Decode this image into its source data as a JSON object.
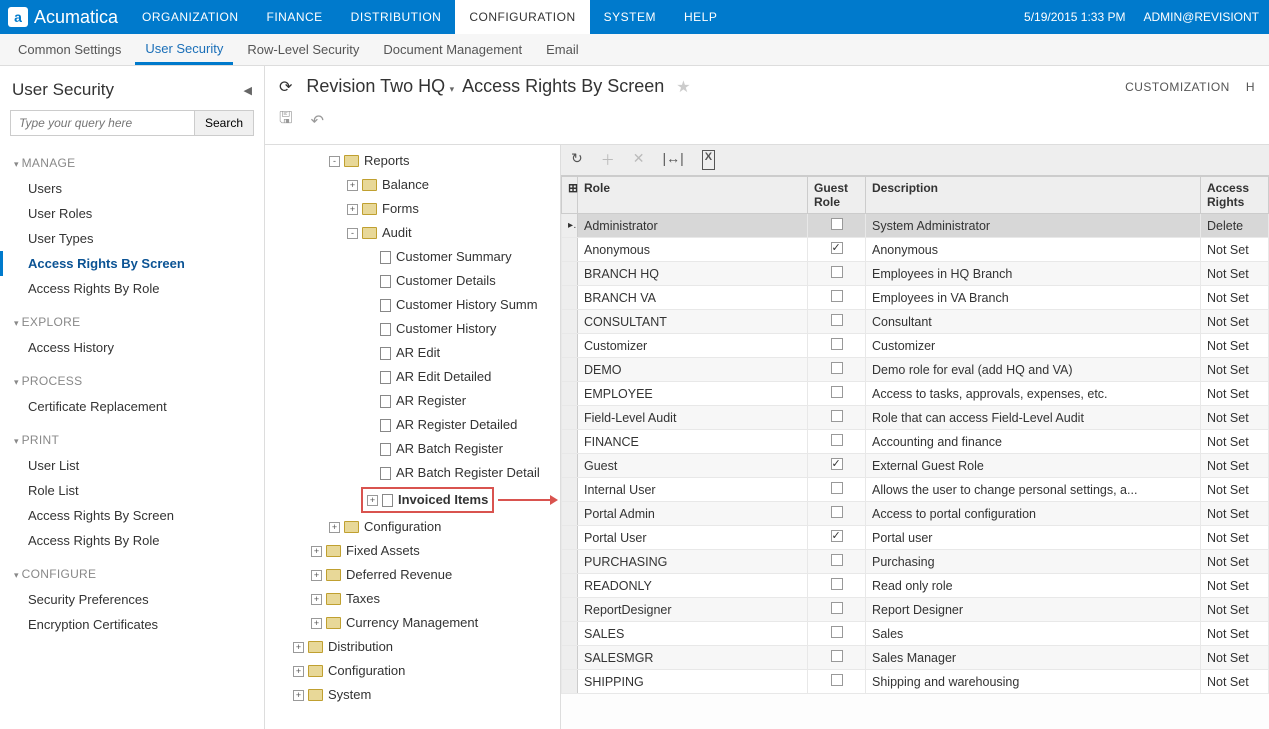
{
  "header": {
    "brand": "Acumatica",
    "mainnav": [
      "ORGANIZATION",
      "FINANCE",
      "DISTRIBUTION",
      "CONFIGURATION",
      "SYSTEM",
      "HELP"
    ],
    "mainnav_active": 3,
    "date": "5/19/2015  1:33 PM",
    "user": "ADMIN@REVISIONT"
  },
  "subnav": {
    "items": [
      "Common Settings",
      "User Security",
      "Row-Level Security",
      "Document Management",
      "Email"
    ],
    "active": 1
  },
  "sidebar": {
    "title": "User Security",
    "search_placeholder": "Type your query here",
    "search_btn": "Search",
    "sections": [
      {
        "heading": "MANAGE",
        "links": [
          "Users",
          "User Roles",
          "User Types",
          "Access Rights By Screen",
          "Access Rights By Role"
        ],
        "active": 3
      },
      {
        "heading": "EXPLORE",
        "links": [
          "Access History"
        ],
        "active": -1
      },
      {
        "heading": "PROCESS",
        "links": [
          "Certificate Replacement"
        ],
        "active": -1
      },
      {
        "heading": "PRINT",
        "links": [
          "User List",
          "Role List",
          "Access Rights By Screen",
          "Access Rights By Role"
        ],
        "active": -1
      },
      {
        "heading": "CONFIGURE",
        "links": [
          "Security Preferences",
          "Encryption Certificates"
        ],
        "active": -1
      }
    ]
  },
  "page": {
    "company": "Revision Two HQ",
    "title": "Access Rights By Screen",
    "right_links": [
      "CUSTOMIZATION",
      "H"
    ]
  },
  "tree": [
    {
      "indent": 3,
      "exp": "-",
      "icon": "folder",
      "label": "Reports"
    },
    {
      "indent": 4,
      "exp": "+",
      "icon": "folder",
      "label": "Balance"
    },
    {
      "indent": 4,
      "exp": "+",
      "icon": "folder",
      "label": "Forms"
    },
    {
      "indent": 4,
      "exp": "-",
      "icon": "folder",
      "label": "Audit"
    },
    {
      "indent": 5,
      "exp": "",
      "icon": "doc",
      "label": "Customer Summary"
    },
    {
      "indent": 5,
      "exp": "",
      "icon": "doc",
      "label": "Customer Details"
    },
    {
      "indent": 5,
      "exp": "",
      "icon": "doc",
      "label": "Customer History Summ"
    },
    {
      "indent": 5,
      "exp": "",
      "icon": "doc",
      "label": "Customer History"
    },
    {
      "indent": 5,
      "exp": "",
      "icon": "doc",
      "label": "AR Edit"
    },
    {
      "indent": 5,
      "exp": "",
      "icon": "doc",
      "label": "AR Edit Detailed"
    },
    {
      "indent": 5,
      "exp": "",
      "icon": "doc",
      "label": "AR Register"
    },
    {
      "indent": 5,
      "exp": "",
      "icon": "doc",
      "label": "AR Register Detailed"
    },
    {
      "indent": 5,
      "exp": "",
      "icon": "doc",
      "label": "AR Batch Register"
    },
    {
      "indent": 5,
      "exp": "",
      "icon": "doc",
      "label": "AR Batch Register Detail"
    },
    {
      "indent": 5,
      "exp": "+",
      "icon": "doc",
      "label": "Invoiced Items",
      "highlight": true
    },
    {
      "indent": 3,
      "exp": "+",
      "icon": "folder",
      "label": "Configuration"
    },
    {
      "indent": 2,
      "exp": "+",
      "icon": "folder",
      "label": "Fixed Assets"
    },
    {
      "indent": 2,
      "exp": "+",
      "icon": "folder",
      "label": "Deferred Revenue"
    },
    {
      "indent": 2,
      "exp": "+",
      "icon": "folder",
      "label": "Taxes"
    },
    {
      "indent": 2,
      "exp": "+",
      "icon": "folder",
      "label": "Currency Management"
    },
    {
      "indent": 1,
      "exp": "+",
      "icon": "folder",
      "label": "Distribution"
    },
    {
      "indent": 1,
      "exp": "+",
      "icon": "folder",
      "label": "Configuration"
    },
    {
      "indent": 1,
      "exp": "+",
      "icon": "folder",
      "label": "System"
    }
  ],
  "grid": {
    "headers": [
      "Role",
      "Guest Role",
      "Description",
      "Access Rights"
    ],
    "rows": [
      {
        "role": "Administrator",
        "guest": false,
        "desc": "System Administrator",
        "rights": "Delete",
        "selected": true
      },
      {
        "role": "Anonymous",
        "guest": true,
        "desc": "Anonymous",
        "rights": "Not Set"
      },
      {
        "role": "BRANCH HQ",
        "guest": false,
        "desc": "Employees in HQ Branch",
        "rights": "Not Set"
      },
      {
        "role": "BRANCH VA",
        "guest": false,
        "desc": "Employees in VA Branch",
        "rights": "Not Set"
      },
      {
        "role": "CONSULTANT",
        "guest": false,
        "desc": "Consultant",
        "rights": "Not Set"
      },
      {
        "role": "Customizer",
        "guest": false,
        "desc": "Customizer",
        "rights": "Not Set"
      },
      {
        "role": "DEMO",
        "guest": false,
        "desc": "Demo role for eval (add HQ and VA)",
        "rights": "Not Set"
      },
      {
        "role": "EMPLOYEE",
        "guest": false,
        "desc": "Access to tasks, approvals, expenses, etc.",
        "rights": "Not Set"
      },
      {
        "role": "Field-Level Audit",
        "guest": false,
        "desc": "Role that can access Field-Level Audit",
        "rights": "Not Set"
      },
      {
        "role": "FINANCE",
        "guest": false,
        "desc": "Accounting and finance",
        "rights": "Not Set"
      },
      {
        "role": "Guest",
        "guest": true,
        "desc": "External Guest Role",
        "rights": "Not Set"
      },
      {
        "role": "Internal User",
        "guest": false,
        "desc": "Allows the user to change personal settings, a...",
        "rights": "Not Set"
      },
      {
        "role": "Portal Admin",
        "guest": false,
        "desc": "Access to portal configuration",
        "rights": "Not Set"
      },
      {
        "role": "Portal User",
        "guest": true,
        "desc": "Portal user",
        "rights": "Not Set"
      },
      {
        "role": "PURCHASING",
        "guest": false,
        "desc": "Purchasing",
        "rights": "Not Set"
      },
      {
        "role": "READONLY",
        "guest": false,
        "desc": "Read only role",
        "rights": "Not Set"
      },
      {
        "role": "ReportDesigner",
        "guest": false,
        "desc": "Report Designer",
        "rights": "Not Set"
      },
      {
        "role": "SALES",
        "guest": false,
        "desc": "Sales",
        "rights": "Not Set"
      },
      {
        "role": "SALESMGR",
        "guest": false,
        "desc": "Sales Manager",
        "rights": "Not Set"
      },
      {
        "role": "SHIPPING",
        "guest": false,
        "desc": "Shipping and warehousing",
        "rights": "Not Set"
      }
    ]
  }
}
